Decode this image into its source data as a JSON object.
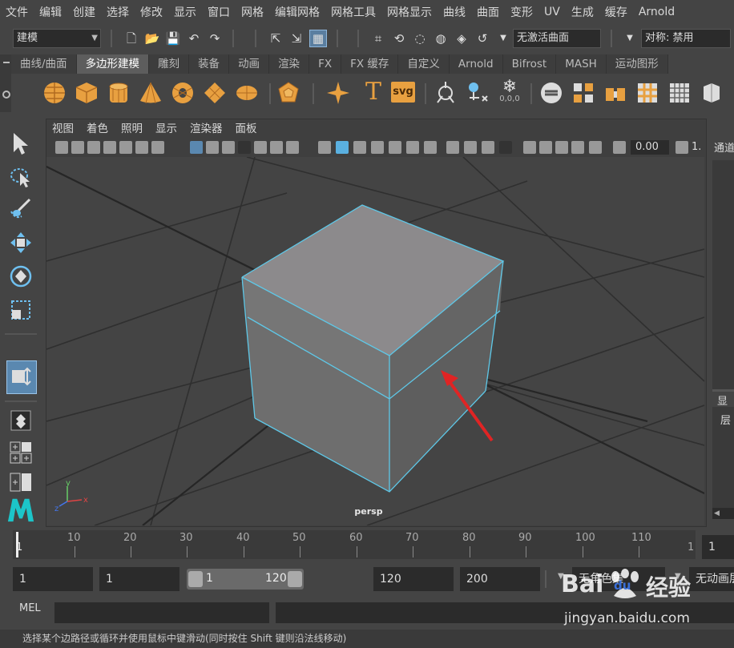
{
  "menu": [
    "文件",
    "编辑",
    "创建",
    "选择",
    "修改",
    "显示",
    "窗口",
    "网格",
    "编辑网格",
    "网格工具",
    "网格显示",
    "曲线",
    "曲面",
    "变形",
    "UV",
    "生成",
    "缓存",
    "Arnold"
  ],
  "status_line": {
    "mode": "建模",
    "live_surface": "无激活曲面",
    "symmetry": "对称: 禁用"
  },
  "shelf_tabs": [
    {
      "label": "曲线/曲面",
      "active": false
    },
    {
      "label": "多边形建模",
      "active": true
    },
    {
      "label": "雕刻",
      "active": false
    },
    {
      "label": "装备",
      "active": false
    },
    {
      "label": "动画",
      "active": false
    },
    {
      "label": "渲染",
      "active": false
    },
    {
      "label": "FX",
      "active": false
    },
    {
      "label": "FX 缓存",
      "active": false
    },
    {
      "label": "自定义",
      "active": false
    },
    {
      "label": "Arnold",
      "active": false
    },
    {
      "label": "Bifrost",
      "active": false
    },
    {
      "label": "MASH",
      "active": false
    },
    {
      "label": "运动图形",
      "active": false
    }
  ],
  "shelf_icons": [
    "sphere-icon",
    "cube-icon",
    "cylinder-icon",
    "cone-icon",
    "torus-icon",
    "plane-icon",
    "disc-icon",
    "platonic-icon",
    "super-shape-icon",
    "type-text-icon",
    "svg-icon",
    "combine-icon",
    "uv-layout-icon",
    "smooth-icon",
    "extrude-icon",
    "bridge-icon",
    "bevel-icon",
    "fill-hole-icon",
    "multi-cut-icon",
    "bool-icon"
  ],
  "shelf_text": {
    "type_glyph": "T",
    "svg_label": "svg",
    "counter_label": "0,0,0"
  },
  "viewport_menu": [
    "视图",
    "着色",
    "照明",
    "显示",
    "渲染器",
    "面板"
  ],
  "viewport_toolbar": {
    "exposure": "0.00",
    "gamma_partial": "1."
  },
  "viewport": {
    "camera": "persp",
    "grid_color": "#2a2a2a",
    "background_color": "#444444",
    "selection_color": "#5ec8e8",
    "annotation_color": "#e02424",
    "axis": {
      "x": "x",
      "y": "y",
      "z": "z"
    }
  },
  "right_panel": {
    "tab_top": "通道",
    "tab_mid": "显",
    "tab_layer": "层"
  },
  "time_slider": {
    "labels": [
      "1",
      "10",
      "20",
      "30",
      "40",
      "50",
      "60",
      "70",
      "80",
      "90",
      "100",
      "110",
      "1"
    ],
    "current": "1"
  },
  "range_slider": {
    "start": "1",
    "playback_start": "1",
    "range_start": "1",
    "range_end": "120",
    "playback_end": "120",
    "end": "200",
    "character_set": "无角色集",
    "anim_layer": "无动画层"
  },
  "command_line": {
    "language": "MEL"
  },
  "help_line": "选择某个边路径或循环并使用鼠标中键滑动(同时按住 Shift 键则沿法线移动)",
  "watermark": {
    "brand": "Bai",
    "du": "du",
    "cn": "经验",
    "url": "jingyan.baidu.com"
  }
}
